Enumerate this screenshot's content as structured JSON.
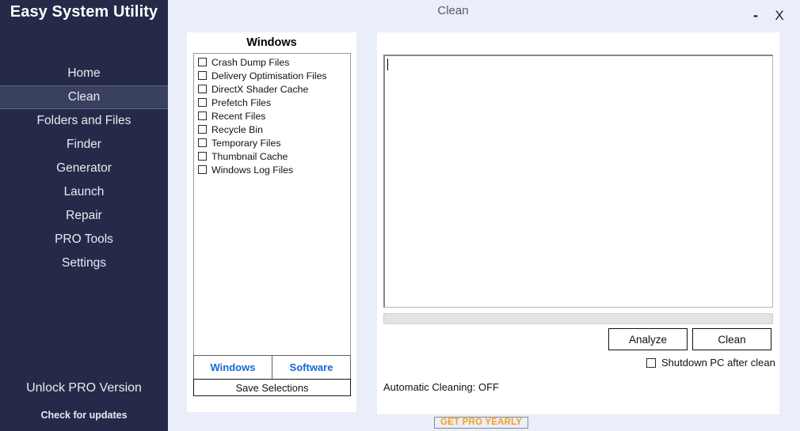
{
  "sidebar": {
    "app_title": "Easy System Utility",
    "items": [
      {
        "label": "Home",
        "active": false
      },
      {
        "label": "Clean",
        "active": true
      },
      {
        "label": "Folders and Files",
        "active": false
      },
      {
        "label": "Finder",
        "active": false
      },
      {
        "label": "Generator",
        "active": false
      },
      {
        "label": "Launch",
        "active": false
      },
      {
        "label": "Repair",
        "active": false
      },
      {
        "label": "PRO Tools",
        "active": false
      },
      {
        "label": "Settings",
        "active": false
      }
    ],
    "unlock_pro": "Unlock PRO Version",
    "check_updates": "Check for updates",
    "bg_color": "#242a47",
    "active_bg_color": "#39415f"
  },
  "titlebar": {
    "title": "Clean",
    "minimize_label": "-",
    "close_label": "X"
  },
  "left_panel": {
    "list_title": "Windows",
    "items": [
      {
        "label": "Crash Dump Files",
        "checked": false
      },
      {
        "label": "Delivery Optimisation Files",
        "checked": false
      },
      {
        "label": "DirectX Shader Cache",
        "checked": false
      },
      {
        "label": "Prefetch Files",
        "checked": false
      },
      {
        "label": "Recent Files",
        "checked": false
      },
      {
        "label": "Recycle Bin",
        "checked": false
      },
      {
        "label": "Temporary Files",
        "checked": false
      },
      {
        "label": "Thumbnail Cache",
        "checked": false
      },
      {
        "label": "Windows Log Files",
        "checked": false
      }
    ],
    "tabs": [
      {
        "label": "Windows",
        "selected": true
      },
      {
        "label": "Software",
        "selected": false
      }
    ],
    "tab_color": "#1668d6",
    "save_selections_label": "Save Selections"
  },
  "right_panel": {
    "log_text": "",
    "progress_percent": 0,
    "analyze_label": "Analyze",
    "clean_label": "Clean",
    "shutdown_label": "Shutdown PC after clean",
    "shutdown_checked": false,
    "automatic_cleaning_status": "Automatic Cleaning: OFF"
  },
  "footer": {
    "get_pro_label": "GET PRO YEARLY",
    "get_pro_color": "#f5a11c"
  }
}
